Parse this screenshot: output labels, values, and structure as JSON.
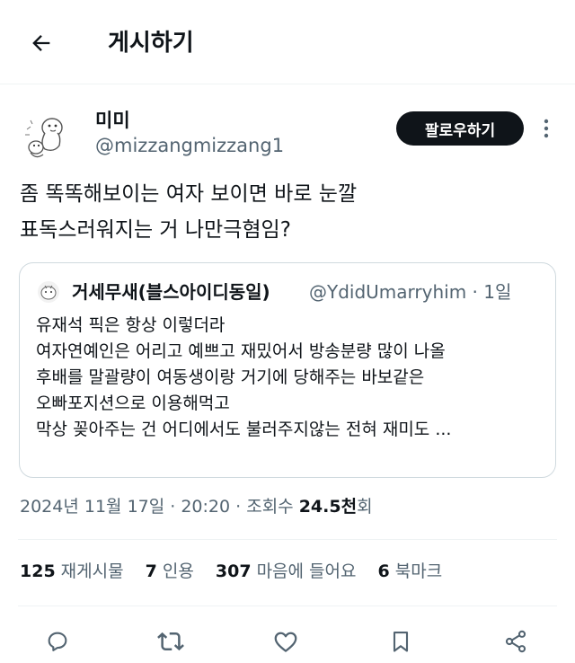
{
  "header": {
    "title": "게시하기",
    "back_icon": "arrow-left-icon"
  },
  "author": {
    "display_name": "미미",
    "handle": "@mizzangmizzang1",
    "follow_label": "팔로우하기"
  },
  "tweet": {
    "lines": [
      "좀 똑똑해보이는 여자 보이면 바로 눈깔",
      "표독스러워지는 거 나만극혐임?"
    ]
  },
  "quote": {
    "name": "거세무새(블스아이디동일)",
    "handle": "@YdidUmarryhim",
    "time": "1일",
    "meta": "@YdidUmarryhim · 1일",
    "lines": [
      "유재석 픽은 항상 이렇더라",
      "여자연예인은 어리고 예쁘고 재밌어서 방송분량 많이 나올",
      "후배를 말괄량이 여동생이랑 거기에 당해주는 바보같은",
      "오빠포지션으로 이용해먹고",
      "막상 꽂아주는 건 어디에서도 불러주지않는 전혀 재미도 ..."
    ]
  },
  "timestamp": {
    "date_time": "2024년 11월 17일 · 20:20 · 조회수 ",
    "views": "24.5천",
    "views_suffix": "회"
  },
  "stats": [
    {
      "count": "125",
      "label": "재게시물"
    },
    {
      "count": "7",
      "label": "인용"
    },
    {
      "count": "307",
      "label": "마음에 들어요"
    },
    {
      "count": "6",
      "label": "북마크"
    }
  ],
  "actions": [
    "reply-icon",
    "retweet-icon",
    "like-icon",
    "bookmark-icon",
    "share-icon"
  ],
  "colors": {
    "text": "#0f1419",
    "secondary": "#536471",
    "border": "#cfd9de",
    "button": "#0f1419"
  }
}
